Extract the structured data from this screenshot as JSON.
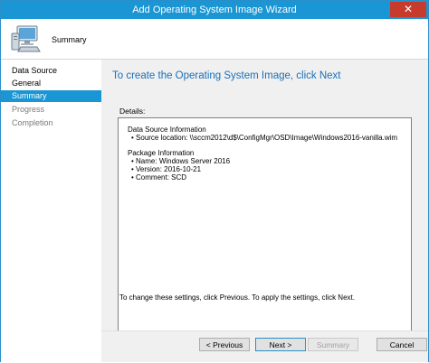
{
  "window": {
    "title": "Add Operating System Image Wizard",
    "close_glyph": "✕"
  },
  "header": {
    "icon": "computer-icon",
    "label": "Summary"
  },
  "sidebar": {
    "items": [
      {
        "label": "Data Source"
      },
      {
        "label": "General"
      },
      {
        "label": "Summary"
      },
      {
        "label": "Progress"
      },
      {
        "label": "Completion"
      }
    ]
  },
  "main": {
    "title": "To create the Operating System Image, click Next",
    "details_label": "Details:",
    "details": {
      "section1_title": "Data Source Information",
      "section1_item1": "Source location: \\\\sccm2012\\d$\\ConfigMgr\\OSD\\Image\\Windows2016-vanilla.wim",
      "section2_title": "Package Information",
      "section2_item1": "Name: Windows Server 2016",
      "section2_item2": "Version: 2016-10-21",
      "section2_item3": "Comment: SCD"
    },
    "hint": "To change these settings, click Previous. To apply the settings, click Next."
  },
  "footer": {
    "previous_label": "< Previous",
    "next_label": "Next >",
    "summary_label": "Summary",
    "cancel_label": "Cancel"
  },
  "colors": {
    "accent": "#1a96d4",
    "title_blue": "#1a6fb8",
    "close_red": "#c73b2d"
  }
}
